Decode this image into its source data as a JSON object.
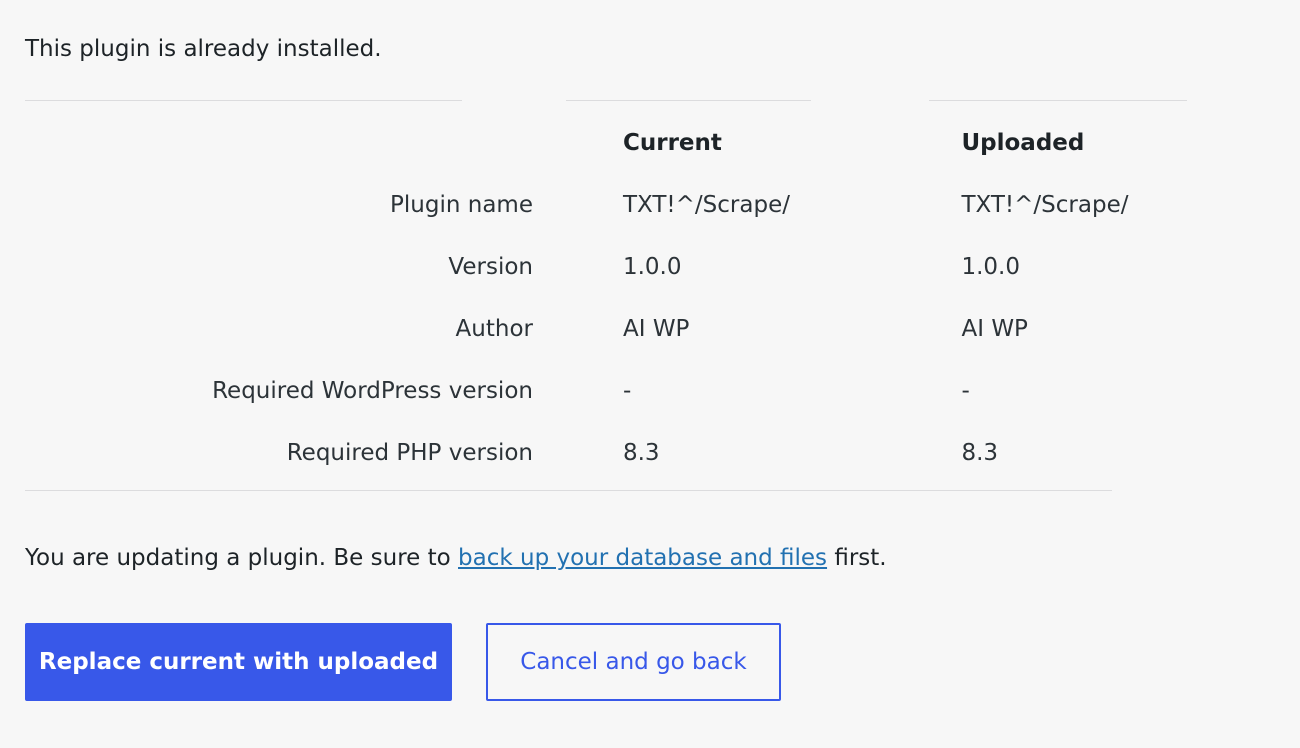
{
  "notice_text": "This plugin is already installed.",
  "table": {
    "headers": {
      "current": "Current",
      "uploaded": "Uploaded"
    },
    "rows": [
      {
        "label": "Plugin name",
        "current": "TXT!^/Scrape/",
        "uploaded": "TXT!^/Scrape/"
      },
      {
        "label": "Version",
        "current": "1.0.0",
        "uploaded": "1.0.0"
      },
      {
        "label": "Author",
        "current": "AI WP",
        "uploaded": "AI WP"
      },
      {
        "label": "Required WordPress version",
        "current": "-",
        "uploaded": "-"
      },
      {
        "label": "Required PHP version",
        "current": "8.3",
        "uploaded": "8.3"
      }
    ]
  },
  "update_message": {
    "before": "You are updating a plugin. Be sure to ",
    "link": "back up your database and files",
    "after": " first."
  },
  "buttons": {
    "replace": "Replace current with uploaded",
    "cancel": "Cancel and go back"
  },
  "colors": {
    "accent": "#3858e9",
    "link": "#2271b1",
    "background": "#f7f7f7"
  }
}
